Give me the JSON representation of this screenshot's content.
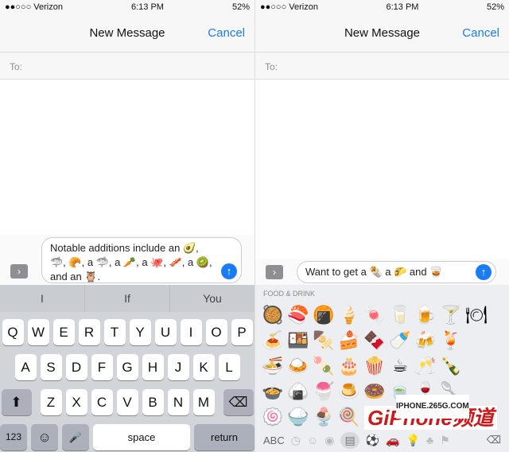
{
  "left": {
    "status": {
      "carrier": "●●○○○ Verizon",
      "time": "6:13 PM",
      "battery": "52%"
    },
    "nav": {
      "title": "New Message",
      "cancel": "Cancel"
    },
    "to": "To:",
    "message": "Notable additions include an 🥑, 🦈, 🥐, a 🦈, a 🥕, a 🐙, 🥓, a 🥝, and an 🦉.",
    "predictions": [
      "I",
      "If",
      "You"
    ],
    "keys": {
      "row1": [
        "Q",
        "W",
        "E",
        "R",
        "T",
        "Y",
        "U",
        "I",
        "O",
        "P"
      ],
      "row2": [
        "A",
        "S",
        "D",
        "F",
        "G",
        "H",
        "J",
        "K",
        "L"
      ],
      "row3": [
        "Z",
        "X",
        "C",
        "V",
        "B",
        "N",
        "M"
      ],
      "shift": "⬆",
      "delete": "⌫",
      "numbers": "123",
      "emoji": "☺",
      "mic": "🎤",
      "space": "space",
      "return": "return"
    }
  },
  "right": {
    "status": {
      "carrier": "●●○○○ Verizon",
      "time": "6:13 PM",
      "battery": "52%"
    },
    "nav": {
      "title": "New Message",
      "cancel": "Cancel"
    },
    "to": "To:",
    "message": "Want to get a 🌯 a 🌮 and 🥃",
    "category": "FOOD & DRINK",
    "emojis": [
      "🥘",
      "🍣",
      "🍘",
      "🍦",
      "🍬",
      "🥛",
      "🍺",
      "🍸",
      "🍽",
      "🍝",
      "🍱",
      "🍢",
      "🍰",
      "🍫",
      "🍼",
      "🍻",
      "🍹",
      "",
      "🍜",
      "🍛",
      "🍡",
      "🎂",
      "🍿",
      "☕",
      "🥂",
      "🍾",
      "",
      "🍲",
      "🍙",
      "🍧",
      "🍮",
      "🍩",
      "🍵",
      "🍷",
      "🥄",
      "",
      "🍥",
      "🍚",
      "🍨",
      "🍭",
      "🍪",
      "🍶",
      "🥛",
      "🍴",
      ""
    ],
    "abc": "ABC",
    "delete": "⌫"
  },
  "watermark": {
    "url": "IPHONE.265G.COM",
    "brand": "GiPhone频道"
  }
}
